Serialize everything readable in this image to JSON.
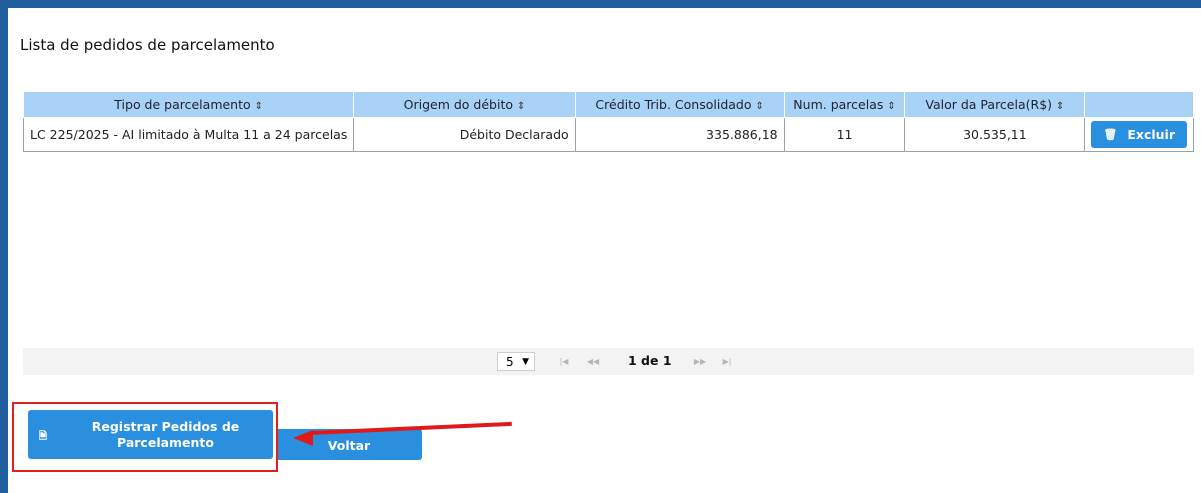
{
  "page": {
    "title": "Lista de pedidos de parcelamento"
  },
  "table": {
    "columns": [
      {
        "label": "Tipo de parcelamento",
        "sort_icon": "sort-icon"
      },
      {
        "label": "Origem do débito",
        "sort_icon": "sort-icon"
      },
      {
        "label": "Crédito Trib. Consolidado",
        "sort_icon": "sort-icon"
      },
      {
        "label": "Num. parcelas",
        "sort_icon": "sort-icon"
      },
      {
        "label": "Valor da Parcela(R$)",
        "sort_icon": "sort-icon"
      },
      {
        "label": ""
      }
    ],
    "rows": [
      {
        "tipo": "LC 225/2025 - AI limitado à Multa 11 a 24 parcelas",
        "origem": "Débito Declarado",
        "credito": "335.886,18",
        "num_parcelas": "11",
        "valor_parcela": "30.535,11",
        "action_label": "Excluir"
      }
    ]
  },
  "paginator": {
    "rows_per_page": "5",
    "current_page_text": "1 de 1"
  },
  "actions": {
    "register_label": "Registrar Pedidos de Parcelamento",
    "back_label": "Voltar"
  },
  "colors": {
    "accent": "#2a8fdf",
    "header_bg": "#a9d3f6",
    "frame": "#1f5d9c",
    "annotation": "#e01a1a"
  }
}
